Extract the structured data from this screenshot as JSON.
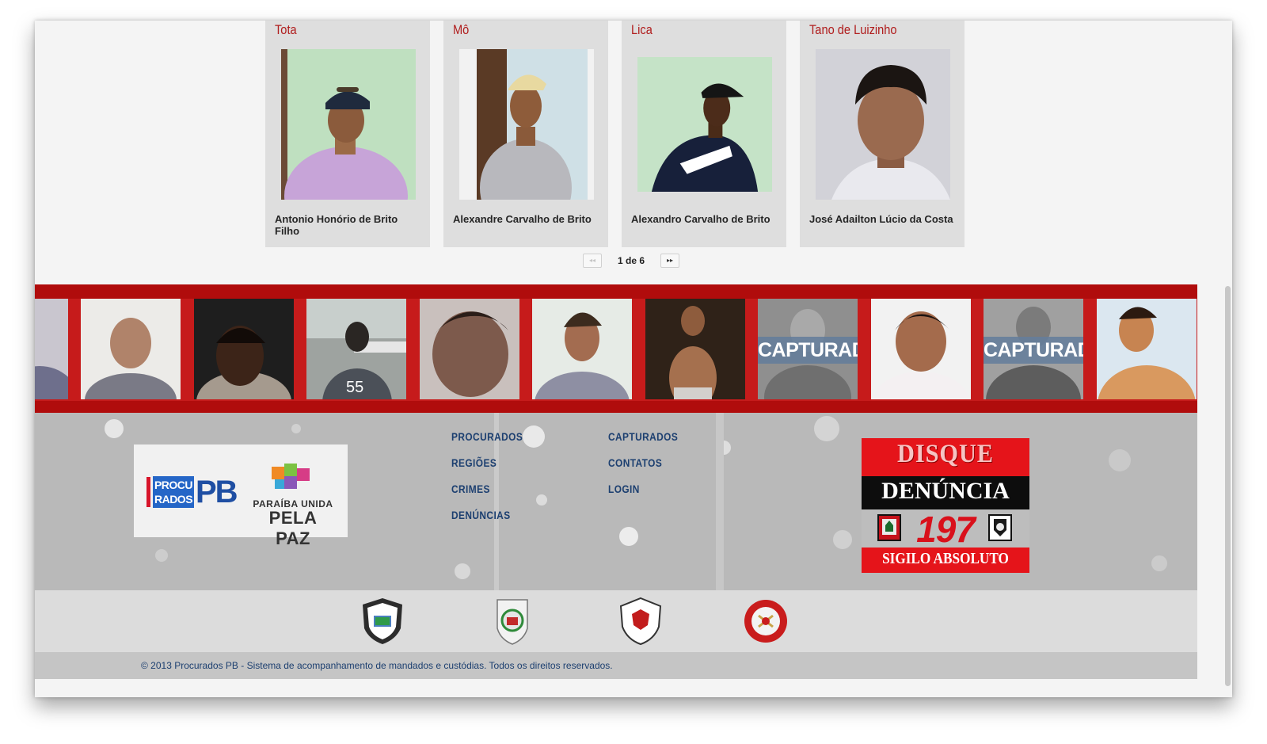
{
  "cards": [
    {
      "nickname": "Tota",
      "name": "Antonio Honório de Brito Filho"
    },
    {
      "nickname": "Mô",
      "name": "Alexandre Carvalho de Brito"
    },
    {
      "nickname": "Lica",
      "name": "Alexandro Carvalho de Brito"
    },
    {
      "nickname": "Tano de Luizinho",
      "name": "José Adailton Lúcio da Costa"
    }
  ],
  "pagination": {
    "label": "1 de 6",
    "prev": "◂◂",
    "next": "▸▸"
  },
  "strip": {
    "captured_label": "CAPTURADO"
  },
  "footer_nav": {
    "col1": [
      "PROCURADOS",
      "REGIÕES",
      "CRIMES",
      "DENÚNCIAS"
    ],
    "col2": [
      "CAPTURADOS",
      "CONTATOS",
      "LOGIN"
    ]
  },
  "logos": {
    "procurados_box": "PROCU\nRADOS",
    "procurados_letters": "PB",
    "paz_top": "PARAÍBA UNIDA",
    "paz_bottom": "PELA PAZ"
  },
  "disque": {
    "title": "DISQUE",
    "subtitle": "DENÚNCIA",
    "number": "197",
    "footer": "SIGILO ABSOLUTO"
  },
  "copyright": "© 2013 Procurados PB - Sistema de acompanhamento de mandados e custódias. Todos os direitos reservados.",
  "colors": {
    "accent_red": "#c61b1b",
    "nav_blue": "#1c3f70",
    "nick_red": "#b01c1c"
  }
}
